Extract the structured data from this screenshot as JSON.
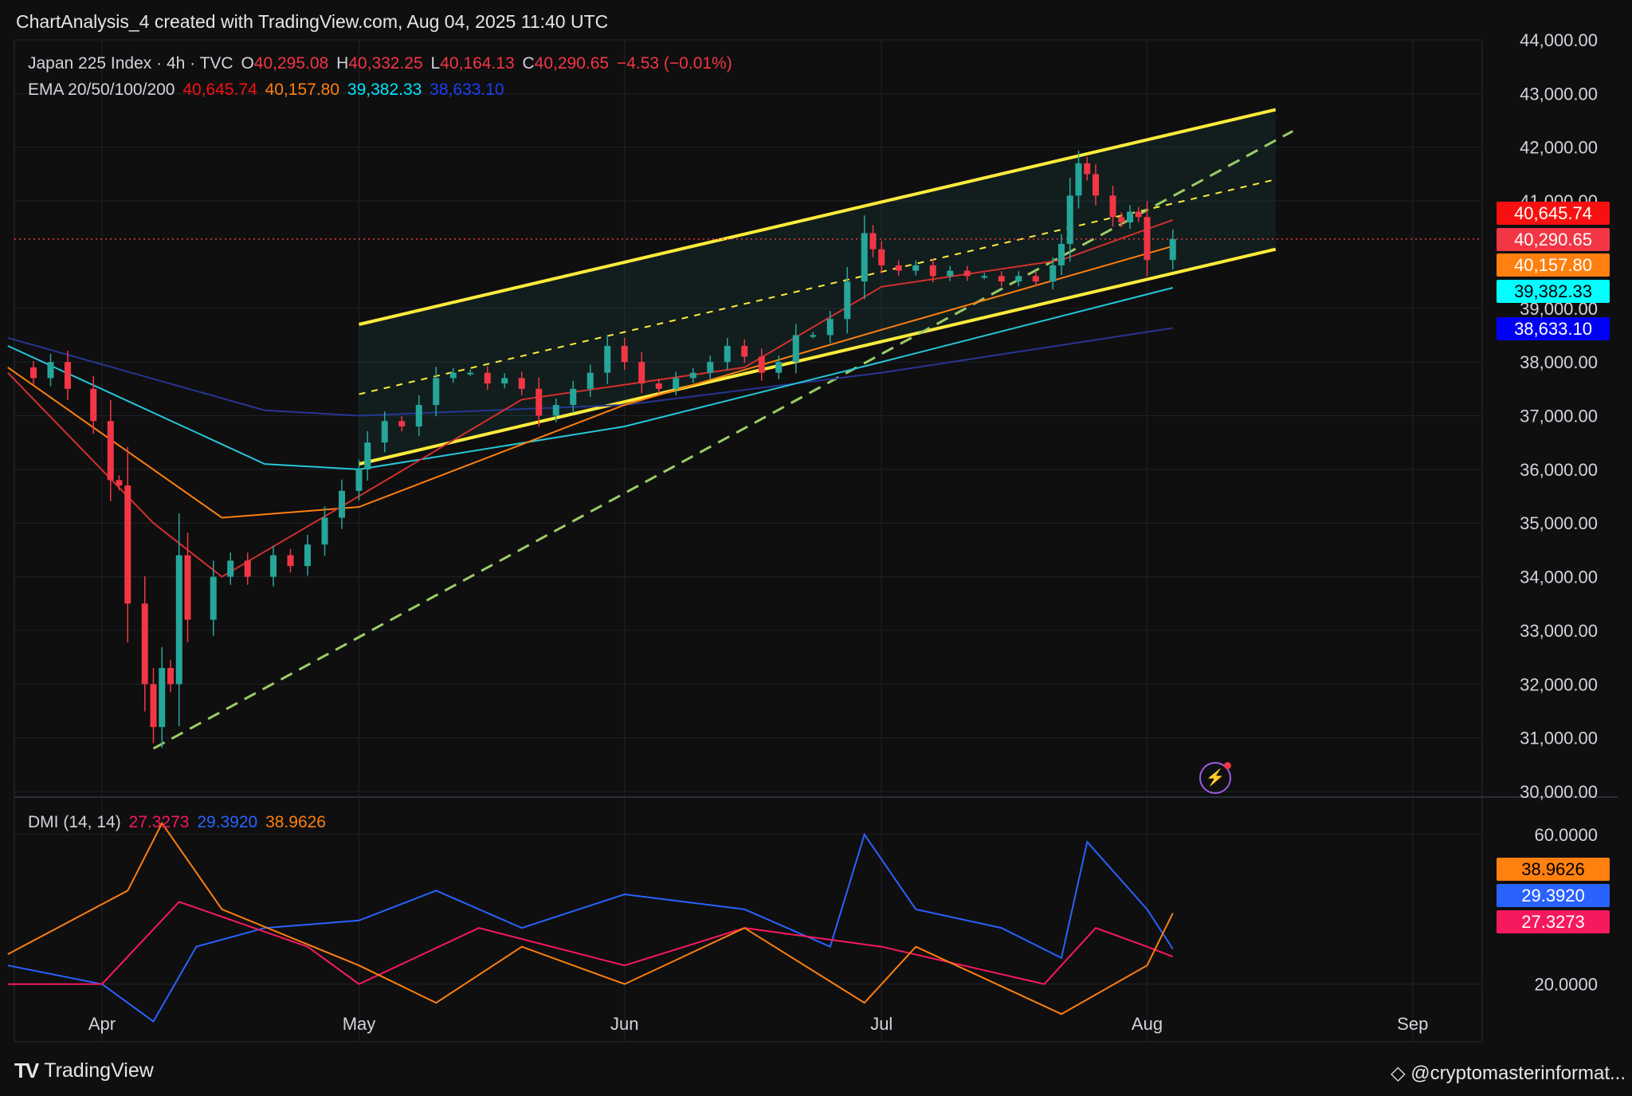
{
  "header": {
    "text": "ChartAnalysis_4 created with TradingView.com, Aug 04, 2025 11:40 UTC"
  },
  "legend": {
    "symbol": "Japan 225 Index · 4h · TVC",
    "o_label": "O",
    "o": "40,295.08",
    "h_label": "H",
    "h": "40,332.25",
    "l_label": "L",
    "l": "40,164.13",
    "c_label": "C",
    "c": "40,290.65",
    "change": "−4.53 (−0.01%)",
    "ema_label": "EMA 20/50/100/200",
    "ema20": "40,645.74",
    "ema50": "40,157.80",
    "ema100": "39,382.33",
    "ema200": "38,633.10",
    "dmi_label": "DMI (14, 14)",
    "dmi1": "27.3273",
    "dmi2": "29.3920",
    "dmi3": "38.9626"
  },
  "price_tags": [
    {
      "text": "40,645.74",
      "bg": "#f7100f",
      "fg": "#ffffff"
    },
    {
      "text": "40,290.65",
      "bg": "#f23645",
      "fg": "#ffffff"
    },
    {
      "text": "40,157.80",
      "bg": "#ff7f0f",
      "fg": "#ffffff"
    },
    {
      "text": "39,382.33",
      "bg": "#00ffff",
      "fg": "#000000"
    },
    {
      "text": "38,633.10",
      "bg": "#0000f5",
      "fg": "#ffffff"
    }
  ],
  "dmi_tags": [
    {
      "text": "38.9626",
      "bg": "#ff7f0f",
      "fg": "#000000"
    },
    {
      "text": "29.3920",
      "bg": "#2962ff",
      "fg": "#ffffff"
    },
    {
      "text": "27.3273",
      "bg": "#f7195e",
      "fg": "#ffffff"
    }
  ],
  "footer": {
    "logo": "TradingView",
    "watermark": "@cryptomasterinformat..."
  },
  "colors": {
    "up": "#26a69a",
    "down": "#f23645",
    "channel": "#ffeb3b",
    "trend": "#9ccc65",
    "ema20": "#d32f2f",
    "ema50": "#ff7f0f",
    "ema100": "#26c6da",
    "ema200": "#283593",
    "plusdi": "#2962ff",
    "minusdi": "#f7195e",
    "adx": "#ff7f0f"
  },
  "chart_data": {
    "type": "candlestick",
    "title": "Japan 225 Index · 4h · TVC",
    "x_ticks": [
      "Apr",
      "May",
      "Jun",
      "Jul",
      "Aug",
      "Sep"
    ],
    "x_tick_dates": [
      "2025-04-01",
      "2025-05-01",
      "2025-06-01",
      "2025-07-01",
      "2025-08-01",
      "2025-09-01"
    ],
    "y_ticks": [
      "30,000.00",
      "31,000.00",
      "32,000.00",
      "33,000.00",
      "34,000.00",
      "35,000.00",
      "36,000.00",
      "37,000.00",
      "38,000.00",
      "39,000.00",
      "41,000.00",
      "42,000.00",
      "43,000.00",
      "44,000.00"
    ],
    "y_range": [
      30000,
      44000
    ],
    "close_series": [
      [
        "2025-03-21",
        37900
      ],
      [
        "2025-03-24",
        37700
      ],
      [
        "2025-03-26",
        38000
      ],
      [
        "2025-03-28",
        37500
      ],
      [
        "2025-03-31",
        36900
      ],
      [
        "2025-04-02",
        35800
      ],
      [
        "2025-04-03",
        35700
      ],
      [
        "2025-04-04",
        33500
      ],
      [
        "2025-04-06",
        32000
      ],
      [
        "2025-04-07",
        31200
      ],
      [
        "2025-04-08",
        32300
      ],
      [
        "2025-04-09",
        32000
      ],
      [
        "2025-04-10",
        34400
      ],
      [
        "2025-04-11",
        33200
      ],
      [
        "2025-04-14",
        34000
      ],
      [
        "2025-04-16",
        34300
      ],
      [
        "2025-04-18",
        34000
      ],
      [
        "2025-04-21",
        34400
      ],
      [
        "2025-04-23",
        34200
      ],
      [
        "2025-04-25",
        34600
      ],
      [
        "2025-04-27",
        35100
      ],
      [
        "2025-04-29",
        35600
      ],
      [
        "2025-05-01",
        36000
      ],
      [
        "2025-05-02",
        36500
      ],
      [
        "2025-05-04",
        36900
      ],
      [
        "2025-05-06",
        36800
      ],
      [
        "2025-05-08",
        37200
      ],
      [
        "2025-05-10",
        37700
      ],
      [
        "2025-05-12",
        37800
      ],
      [
        "2025-05-14",
        37800
      ],
      [
        "2025-05-16",
        37600
      ],
      [
        "2025-05-18",
        37700
      ],
      [
        "2025-05-20",
        37500
      ],
      [
        "2025-05-22",
        37000
      ],
      [
        "2025-05-24",
        37200
      ],
      [
        "2025-05-26",
        37500
      ],
      [
        "2025-05-28",
        37800
      ],
      [
        "2025-05-30",
        38300
      ],
      [
        "2025-06-01",
        38000
      ],
      [
        "2025-06-03",
        37600
      ],
      [
        "2025-06-05",
        37500
      ],
      [
        "2025-06-07",
        37700
      ],
      [
        "2025-06-09",
        37800
      ],
      [
        "2025-06-11",
        38000
      ],
      [
        "2025-06-13",
        38300
      ],
      [
        "2025-06-15",
        38100
      ],
      [
        "2025-06-17",
        37800
      ],
      [
        "2025-06-19",
        38000
      ],
      [
        "2025-06-21",
        38500
      ],
      [
        "2025-06-23",
        38500
      ],
      [
        "2025-06-25",
        38800
      ],
      [
        "2025-06-27",
        39500
      ],
      [
        "2025-06-29",
        40400
      ],
      [
        "2025-06-30",
        40100
      ],
      [
        "2025-07-01",
        39800
      ],
      [
        "2025-07-03",
        39700
      ],
      [
        "2025-07-05",
        39800
      ],
      [
        "2025-07-07",
        39600
      ],
      [
        "2025-07-09",
        39700
      ],
      [
        "2025-07-11",
        39600
      ],
      [
        "2025-07-13",
        39600
      ],
      [
        "2025-07-15",
        39500
      ],
      [
        "2025-07-17",
        39600
      ],
      [
        "2025-07-19",
        39500
      ],
      [
        "2025-07-21",
        39800
      ],
      [
        "2025-07-22",
        40200
      ],
      [
        "2025-07-23",
        41100
      ],
      [
        "2025-07-24",
        41700
      ],
      [
        "2025-07-25",
        41500
      ],
      [
        "2025-07-26",
        41100
      ],
      [
        "2025-07-28",
        40700
      ],
      [
        "2025-07-29",
        40600
      ],
      [
        "2025-07-30",
        40800
      ],
      [
        "2025-07-31",
        40700
      ],
      [
        "2025-08-01",
        39900
      ],
      [
        "2025-08-04",
        40290.65
      ]
    ],
    "ema20": [
      [
        "2025-03-21",
        37800
      ],
      [
        "2025-04-07",
        35000
      ],
      [
        "2025-04-15",
        34000
      ],
      [
        "2025-05-01",
        35500
      ],
      [
        "2025-05-20",
        37300
      ],
      [
        "2025-06-15",
        37900
      ],
      [
        "2025-07-01",
        39400
      ],
      [
        "2025-07-22",
        39900
      ],
      [
        "2025-08-04",
        40645.74
      ]
    ],
    "ema50": [
      [
        "2025-03-21",
        37900
      ],
      [
        "2025-04-15",
        35100
      ],
      [
        "2025-05-01",
        35300
      ],
      [
        "2025-06-01",
        37200
      ],
      [
        "2025-07-01",
        38600
      ],
      [
        "2025-08-04",
        40157.8
      ]
    ],
    "ema100": [
      [
        "2025-03-21",
        38300
      ],
      [
        "2025-04-20",
        36100
      ],
      [
        "2025-05-01",
        36000
      ],
      [
        "2025-06-01",
        36800
      ],
      [
        "2025-07-01",
        38000
      ],
      [
        "2025-08-04",
        39382.33
      ]
    ],
    "ema200": [
      [
        "2025-03-21",
        38450
      ],
      [
        "2025-04-20",
        37100
      ],
      [
        "2025-05-01",
        37000
      ],
      [
        "2025-06-01",
        37200
      ],
      [
        "2025-07-01",
        37800
      ],
      [
        "2025-08-04",
        38633.1
      ]
    ],
    "channel_upper": [
      [
        "2025-05-01",
        38700
      ],
      [
        "2025-08-16",
        42700
      ]
    ],
    "channel_lower": [
      [
        "2025-05-01",
        36100
      ],
      [
        "2025-08-16",
        40100
      ]
    ],
    "channel_mid": [
      [
        "2025-05-01",
        37400
      ],
      [
        "2025-08-16",
        41400
      ]
    ],
    "trendline": [
      [
        "2025-04-07",
        30800
      ],
      [
        "2025-08-18",
        42300
      ]
    ],
    "current_price": 40290.65,
    "dmi": {
      "y_ticks": [
        "20.0000",
        "60.0000"
      ],
      "y_range": [
        5,
        70
      ],
      "plus_di": [
        [
          "2025-03-21",
          25
        ],
        [
          "2025-04-01",
          20
        ],
        [
          "2025-04-07",
          10
        ],
        [
          "2025-04-12",
          30
        ],
        [
          "2025-04-20",
          35
        ],
        [
          "2025-05-01",
          37
        ],
        [
          "2025-05-10",
          45
        ],
        [
          "2025-05-20",
          35
        ],
        [
          "2025-06-01",
          44
        ],
        [
          "2025-06-15",
          40
        ],
        [
          "2025-06-25",
          30
        ],
        [
          "2025-06-29",
          60
        ],
        [
          "2025-07-05",
          40
        ],
        [
          "2025-07-15",
          35
        ],
        [
          "2025-07-22",
          27
        ],
        [
          "2025-07-25",
          58
        ],
        [
          "2025-08-01",
          40
        ],
        [
          "2025-08-04",
          29.392
        ]
      ],
      "minus_di": [
        [
          "2025-03-21",
          20
        ],
        [
          "2025-04-01",
          20
        ],
        [
          "2025-04-10",
          42
        ],
        [
          "2025-04-25",
          30
        ],
        [
          "2025-05-01",
          20
        ],
        [
          "2025-05-15",
          35
        ],
        [
          "2025-06-01",
          25
        ],
        [
          "2025-06-15",
          35
        ],
        [
          "2025-07-01",
          30
        ],
        [
          "2025-07-20",
          20
        ],
        [
          "2025-07-26",
          35
        ],
        [
          "2025-08-01",
          30
        ],
        [
          "2025-08-04",
          27.3273
        ]
      ],
      "adx": [
        [
          "2025-03-21",
          28
        ],
        [
          "2025-04-04",
          45
        ],
        [
          "2025-04-08",
          63
        ],
        [
          "2025-04-15",
          40
        ],
        [
          "2025-05-01",
          25
        ],
        [
          "2025-05-10",
          15
        ],
        [
          "2025-05-20",
          30
        ],
        [
          "2025-06-01",
          20
        ],
        [
          "2025-06-15",
          35
        ],
        [
          "2025-06-29",
          15
        ],
        [
          "2025-07-05",
          30
        ],
        [
          "2025-07-22",
          12
        ],
        [
          "2025-08-01",
          25
        ],
        [
          "2025-08-04",
          38.9626
        ]
      ]
    }
  }
}
